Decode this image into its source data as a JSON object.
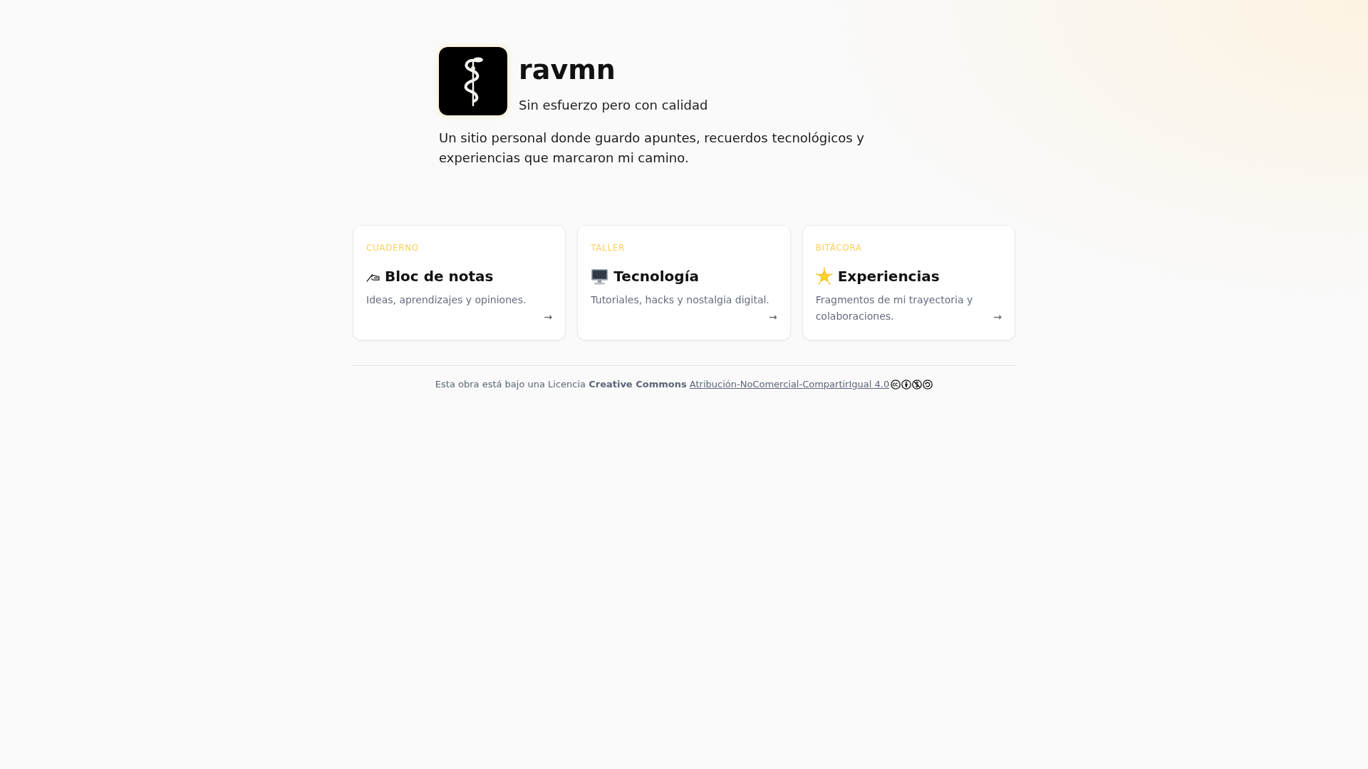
{
  "site": {
    "title": "ravmn",
    "tagline": "Sin esfuerzo pero con calidad",
    "description": "Un sitio personal donde guardo apuntes, recuerdos tecnológicos y experiencias que marcaron mi camino."
  },
  "cards": [
    {
      "label": "CUADERNO",
      "title": "Bloc de notas",
      "description": "Ideas, aprendizajes y opiniones.",
      "arrow": "→"
    },
    {
      "label": "TALLER",
      "title": "Tecnología",
      "description": "Tutoriales, hacks y nostalgia digital.",
      "arrow": "→"
    },
    {
      "label": "BITÁCORA",
      "title": "Experiencias",
      "description": "Fragmentos de mi trayectoria y colaboraciones.",
      "arrow": "→"
    }
  ],
  "footer": {
    "text": "Esta obra está bajo una Licencia **Creative Commons**",
    "link": "Atribución-NoComercial-CompartirIgual 4.0"
  }
}
